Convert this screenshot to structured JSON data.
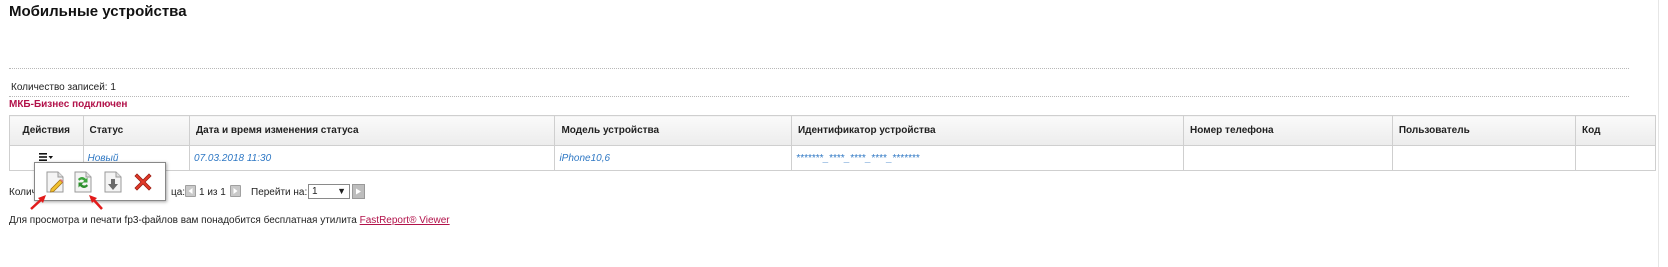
{
  "page": {
    "title": "Мобильные устройства"
  },
  "records": {
    "label": "Количество записей: 1"
  },
  "status_line": {
    "text": "МКБ-Бизнес подключен",
    "color": "#b2124a"
  },
  "table": {
    "headers": [
      "Действия",
      "Статус",
      "Дата и время изменения статуса",
      "Модель устройства",
      "Идентификатор устройства",
      "Номер телефона",
      "Пользователь",
      "Код"
    ],
    "rows": [
      {
        "actions_icon": "menu-icon",
        "status": "Новый",
        "date": "07.03.2018 11:30",
        "model": "iPhone10,6",
        "device_id": "*******_****_****_****_*******",
        "phone": "",
        "user": "",
        "code": ""
      }
    ]
  },
  "actions_menu": {
    "items": [
      "edit-icon",
      "recycle-icon",
      "download-icon",
      "delete-icon"
    ]
  },
  "pager": {
    "count_label_visible": "Колич",
    "page_label_visible": "ца:",
    "page_of": "1 из 1",
    "goto_label": "Перейти на:",
    "goto_value": "1"
  },
  "footer": {
    "text": "Для просмотра и печати fp3-файлов вам понадобится бесплатная утилита",
    "link": "FastReport® Viewer"
  },
  "colors": {
    "accent": "#b2124a",
    "link_blue": "#2f78c4",
    "arrow_red": "#e21b1b"
  }
}
